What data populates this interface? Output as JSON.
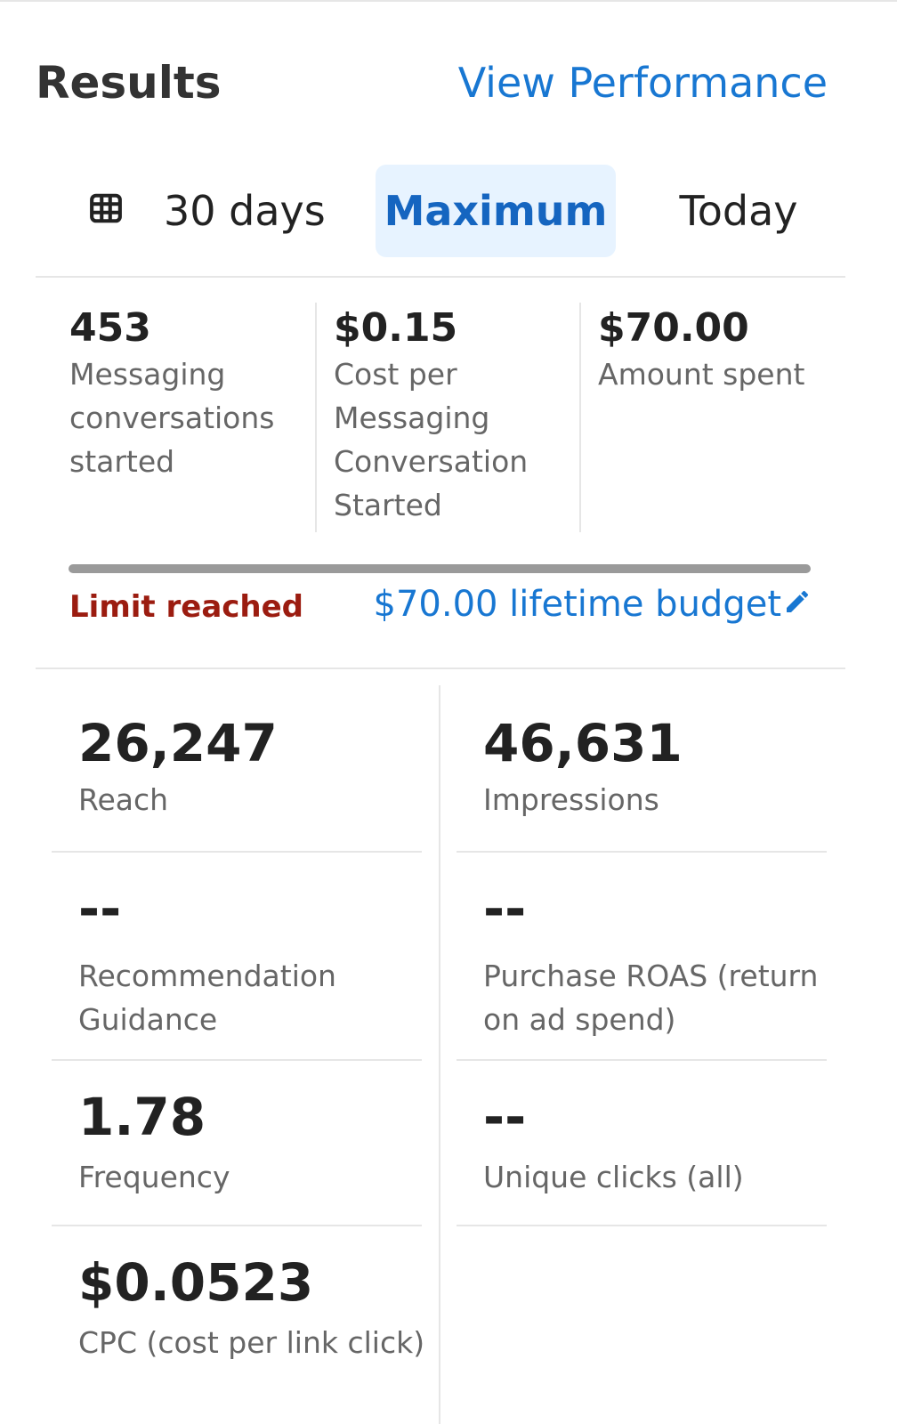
{
  "header": {
    "title": "Results",
    "link": "View Performance"
  },
  "tabs": {
    "range": "30 days",
    "maximum": "Maximum",
    "today": "Today",
    "selected": "Maximum"
  },
  "summary": [
    {
      "value": "453",
      "label_lines": [
        "Messaging",
        "conversations",
        "started"
      ]
    },
    {
      "value": "$0.15",
      "label_lines": [
        "Cost per",
        "Messaging",
        "Conversation",
        "Started"
      ]
    },
    {
      "value": "$70.00",
      "label_lines": [
        "Amount spent"
      ]
    }
  ],
  "budget": {
    "status": "Limit reached",
    "text": "$70.00 lifetime budget",
    "progress_fraction": 1.0
  },
  "metrics": [
    {
      "value": "26,247",
      "label": "Reach"
    },
    {
      "value": "46,631",
      "label": "Impressions"
    },
    {
      "value": "--",
      "label_lines": [
        "Recommendation",
        "Guidance"
      ]
    },
    {
      "value": "--",
      "label_lines": [
        "Purchase ROAS (return",
        "on ad spend)"
      ]
    },
    {
      "value": "1.78",
      "label": "Frequency"
    },
    {
      "value": "--",
      "label": "Unique clicks (all)"
    },
    {
      "value": "$0.0523",
      "label": "CPC (cost per link click)"
    }
  ],
  "colors": {
    "accent": "#1877d2",
    "selected_bg": "#e7f3ff",
    "limit": "#9b1c10"
  },
  "icons": {
    "range": "calendar-grid-icon",
    "edit": "pencil-icon"
  }
}
